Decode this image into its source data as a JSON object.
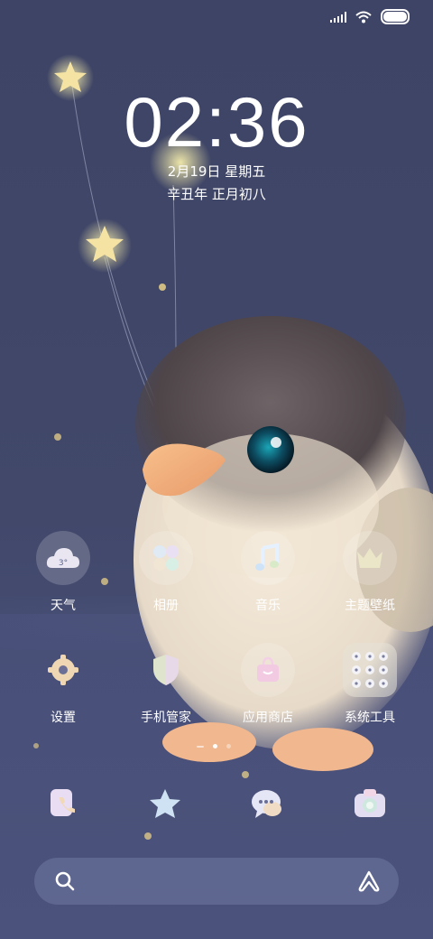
{
  "status_bar": {
    "icons": [
      "signal-icon",
      "wifi-icon",
      "battery-icon"
    ]
  },
  "lockscreen": {
    "time": "02:36",
    "date": "2月19日 星期五",
    "lunar": "辛丑年 正月初八"
  },
  "apps": [
    {
      "label": "天气",
      "icon": "weather-cloud-icon",
      "badge": "3°"
    },
    {
      "label": "相册",
      "icon": "gallery-icon"
    },
    {
      "label": "音乐",
      "icon": "music-note-icon"
    },
    {
      "label": "主题壁纸",
      "icon": "crown-icon"
    },
    {
      "label": "设置",
      "icon": "gear-icon"
    },
    {
      "label": "手机管家",
      "icon": "shield-icon"
    },
    {
      "label": "应用商店",
      "icon": "shopping-bag-icon"
    },
    {
      "label": "系统工具",
      "icon": "tools-folder-icon"
    }
  ],
  "dock": [
    {
      "icon": "phone-icon"
    },
    {
      "icon": "star-icon"
    },
    {
      "icon": "chat-bubble-icon"
    },
    {
      "icon": "camera-icon"
    }
  ],
  "pager": {
    "pages": 3,
    "active": 1
  },
  "search_bar": {
    "icons": [
      "search-icon",
      "assistant-icon"
    ]
  }
}
